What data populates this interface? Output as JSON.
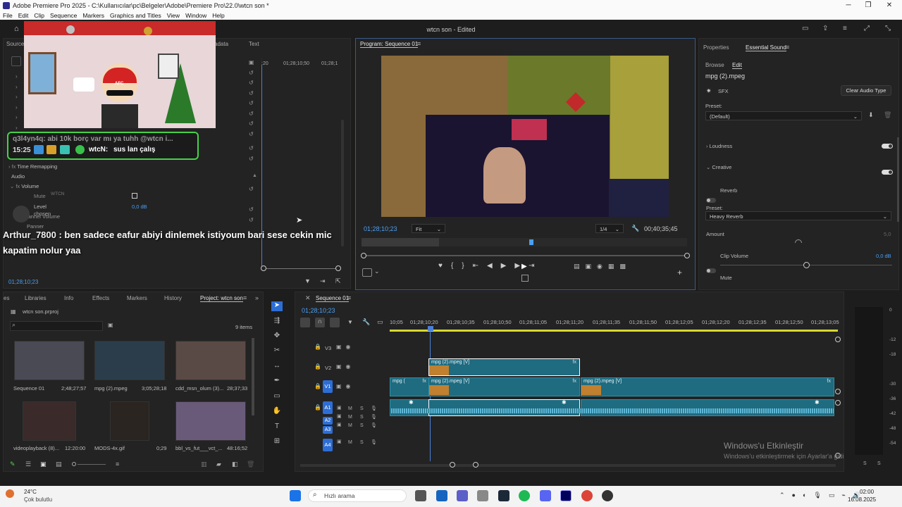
{
  "window": {
    "title": "Adobe Premiere Pro 2025 - C:\\Kullanıcılar\\pc\\Belgeler\\Adobe\\Premiere Pro\\22.0\\wtcn son *",
    "project_status": "wtcn son - Edited"
  },
  "menu": [
    "File",
    "Edit",
    "Clip",
    "Sequence",
    "Markers",
    "Graphics and Titles",
    "View",
    "Window",
    "Help"
  ],
  "source_panel": {
    "tabs": [
      "Source:",
      "adata",
      "Text"
    ],
    "time_remapping": "Time Remapping",
    "audio_label": "Audio",
    "volume": "Volume",
    "mute": "Mute",
    "level": "Level",
    "level_value": "0,0 dB",
    "channel_volume": "Channel Volume",
    "panner": "Panner",
    "timecodes": [
      ":20",
      "01;28;10;50",
      "01;28;1"
    ],
    "current_time": "01;28;10;23"
  },
  "overlay": {
    "chat_user": "q3l4yn4q: abi 10k borç var mı ya tuhh @wtcn i...",
    "chat_time": "15:25",
    "chat_reply_name": "wtcN:",
    "chat_reply": "sus lan çalış",
    "watermark": "WTCN",
    "caption_user": "Arthur_7800",
    "caption_text": " : ben sadece eafur abiyi dinlemek istiyoum bari sese cekin mic kapatim nolur yaa",
    "sub_name": "chosen",
    "cam_sign": "AFC"
  },
  "program": {
    "tab": "Program: Sequence 01",
    "timecode": "01;28;10;23",
    "fit": "Fit",
    "quality": "1/4",
    "duration": "00;40;35;45"
  },
  "essential_sound": {
    "tabs": [
      "Properties",
      "Essential Sound"
    ],
    "sub_tabs": [
      "Browse",
      "Edit"
    ],
    "clip_name": "mpg (2).mpeg",
    "sfx": "SFX",
    "clear_button": "Clear Audio Type",
    "preset_label": "Preset:",
    "preset_value": "(Default)",
    "loudness": "Loudness",
    "creative": "Creative",
    "reverb": "Reverb",
    "reverb_preset_label": "Preset:",
    "reverb_preset": "Heavy Reverb",
    "amount": "Amount",
    "amount_value": "5,0",
    "clip_volume": "Clip Volume",
    "clip_volume_value": "0,0 dB",
    "mute": "Mute"
  },
  "project_panel": {
    "tabs": [
      "es",
      "Libraries",
      "Info",
      "Effects",
      "Markers",
      "History",
      "Project: wtcn son"
    ],
    "file": "wtcn son.prproj",
    "items_count": "9 items",
    "items": [
      {
        "name": "Sequence 01",
        "dur": "2;48;27;57"
      },
      {
        "name": "mpg (2).mpeg",
        "dur": "3;05;28;18"
      },
      {
        "name": "cdd_msn_olum (3)...",
        "dur": "28;37;33"
      },
      {
        "name": "videoplayback (8)...",
        "dur": "12:20:00"
      },
      {
        "name": "MODS-4x.gif",
        "dur": "0;29"
      },
      {
        "name": "bbl_vs_fut___vct_...",
        "dur": "48:16;52"
      }
    ]
  },
  "timeline": {
    "tab": "Sequence 01",
    "timecode": "01;28;10;23",
    "ruler": [
      "10;05",
      "01;28;10;20",
      "01;28;10;35",
      "01;28;10;50",
      "01;28;11;05",
      "01;28;11;20",
      "01;28;11;35",
      "01;28;11;50",
      "01;28;12;05",
      "01;28;12;20",
      "01;28;12;35",
      "01;28;12;50",
      "01;28;13;05"
    ],
    "tracks_v": [
      "V3",
      "V2",
      "V1"
    ],
    "tracks_a": [
      "A1",
      "A2",
      "A3",
      "A4"
    ],
    "clips": {
      "v2": "mpg (2).mpeg [V]",
      "v1a": "mpg (",
      "v1b": "mpg (2).mpeg [V]",
      "v1c": "mpg (2).mpeg [V]"
    },
    "track_btn_m": "M",
    "track_btn_s": "S"
  },
  "meter": {
    "labels": [
      "0",
      "-12",
      "-18",
      "-30",
      "-36",
      "-42",
      "-48",
      "-54"
    ],
    "bottom": [
      "S",
      "S"
    ]
  },
  "activation": {
    "title": "Windows'u Etkinleştir",
    "sub": "Windows'u etkinleştirmek için Ayarlar'a gidin."
  },
  "taskbar": {
    "weather_temp": "24°C",
    "weather_desc": "Çok bulutlu",
    "search": "Hızlı arama",
    "time": "02:00",
    "date": "16.08.2025"
  }
}
